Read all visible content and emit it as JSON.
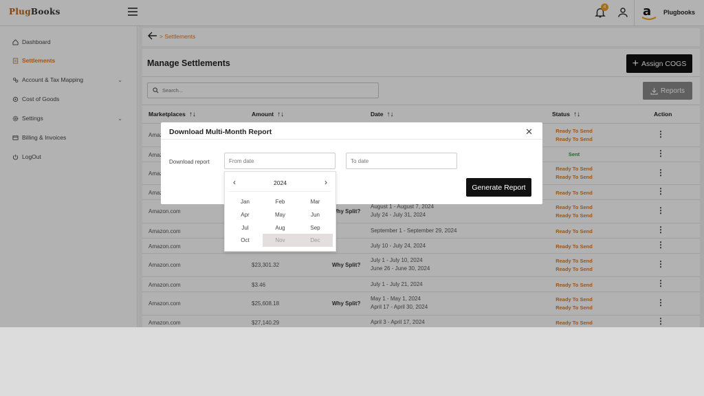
{
  "app": {
    "logo_part1": "Plug",
    "logo_part2": "Books",
    "notification_count": "4",
    "store_name": "Plugbooks"
  },
  "sidebar": {
    "items": [
      {
        "label": "Dashboard",
        "icon": "home-icon"
      },
      {
        "label": "Settlements",
        "icon": "document-icon",
        "active": true
      },
      {
        "label": "Account & Tax Mapping",
        "icon": "account-icon",
        "chevron": "⌄"
      },
      {
        "label": "Cost of Goods",
        "icon": "gear-icon",
        "chevron": "⌄"
      },
      {
        "label": "Settings",
        "icon": "settings-icon",
        "chevron": "⌄"
      },
      {
        "label": "Billing & Invoices",
        "icon": "billing-icon"
      },
      {
        "label": "LogOut",
        "icon": "logout-icon"
      }
    ]
  },
  "breadcrumb": {
    "current": "Settlements",
    "separator": ">"
  },
  "page": {
    "title": "Manage Settlements",
    "assign_label": "Assign COGS",
    "reports_label": "Reports",
    "search_placeholder": "Search..."
  },
  "table": {
    "headers": [
      "Marketplaces",
      "Amount",
      "Date",
      "Status",
      "Action"
    ],
    "sort_icon": "↑↓",
    "rows": [
      {
        "marketplace": "Amazon.com",
        "amount": "",
        "split": "",
        "date1": "",
        "date2": "",
        "status1": "Ready To Send",
        "status2": "Ready To Send"
      },
      {
        "marketplace": "Amazon.com",
        "amount": "",
        "split": "",
        "date1": "",
        "date2": "",
        "status1": "Sent",
        "status2": ""
      },
      {
        "marketplace": "Amazon.com",
        "amount": "",
        "split": "",
        "date1": "",
        "date2": "",
        "status1": "Ready To Send",
        "status2": "Ready To Send"
      },
      {
        "marketplace": "Amazon.com",
        "amount": "",
        "split": "",
        "date1": "",
        "date2": "",
        "status1": "Ready To Send",
        "status2": ""
      },
      {
        "marketplace": "Amazon.com",
        "amount": "",
        "split": "Why Split?",
        "date1": "August 1 - August 7, 2024",
        "date2": "July 24 - July 31, 2024",
        "status1": "Ready To Send",
        "status2": "Ready To Send"
      },
      {
        "marketplace": "Amazon.com",
        "amount": "",
        "split": "",
        "date1": "September 1 - September 29, 2024",
        "date2": "",
        "status1": "Ready To Send",
        "status2": ""
      },
      {
        "marketplace": "Amazon.com",
        "amount": "",
        "split": "",
        "date1": "July 10 - July 24, 2024",
        "date2": "",
        "status1": "Ready To Send",
        "status2": ""
      },
      {
        "marketplace": "Amazon.com",
        "amount": "$23,301.32",
        "split": "Why Split?",
        "date1": "July 1 - July 10, 2024",
        "date2": "June 26 - June 30, 2024",
        "status1": "Ready To Send",
        "status2": "Ready To Send"
      },
      {
        "marketplace": "Amazon.com",
        "amount": "$3.46",
        "split": "",
        "date1": "July 1 - July 21, 2024",
        "date2": "",
        "status1": "Ready To Send",
        "status2": ""
      },
      {
        "marketplace": "Amazon.com",
        "amount": "$25,608.18",
        "split": "Why Split?",
        "date1": "May 1 - May 1, 2024",
        "date2": "April 17 - April 30, 2024",
        "status1": "Ready To Send",
        "status2": "Ready To Send"
      },
      {
        "marketplace": "Amazon.com",
        "amount": "$27,140.29",
        "split": "",
        "date1": "April 3 - April 17, 2024",
        "date2": "",
        "status1": "Ready To Send",
        "status2": ""
      }
    ]
  },
  "modal": {
    "title": "Download Multi-Month Report",
    "close": "✕",
    "label": "Download report",
    "from_placeholder": "From date",
    "to_placeholder": "To date",
    "generate_label": "Generate Report"
  },
  "picker": {
    "year": "2024",
    "prev": "‹",
    "next": "›",
    "months": [
      "Jan",
      "Feb",
      "Mar",
      "Apr",
      "May",
      "Jun",
      "Jul",
      "Aug",
      "Sep",
      "Oct",
      "Nov",
      "Dec"
    ],
    "disabled": [
      "Nov",
      "Dec"
    ]
  }
}
